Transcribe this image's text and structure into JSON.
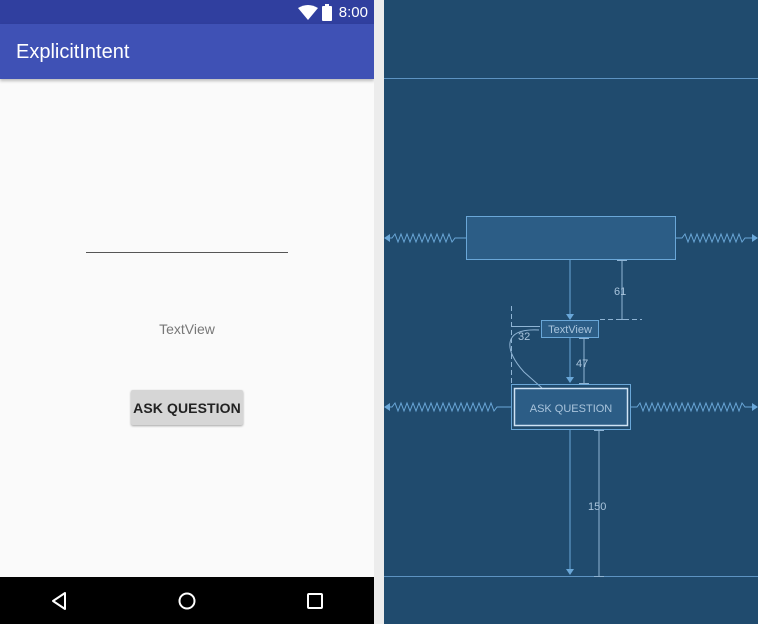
{
  "status_bar": {
    "time": "8:00"
  },
  "app_bar": {
    "title": "ExplicitIntent"
  },
  "content": {
    "text_view": "TextView",
    "button_label": "ASK QUESTION"
  },
  "blueprint": {
    "text_view_label": "TextView",
    "button_label": "ASK QUESTION",
    "margins": {
      "edit_text_to_text_view": "61",
      "text_view_left": "32",
      "text_view_to_button": "47",
      "button_to_bottom": "150"
    }
  },
  "colors": {
    "status_bar": "#303f9f",
    "app_bar": "#3f51b5",
    "blueprint_background": "#204b6e",
    "blueprint_line": "#6aa7d8"
  },
  "icons": [
    "wifi-icon",
    "battery-icon",
    "back-icon",
    "home-icon",
    "recents-icon"
  ]
}
